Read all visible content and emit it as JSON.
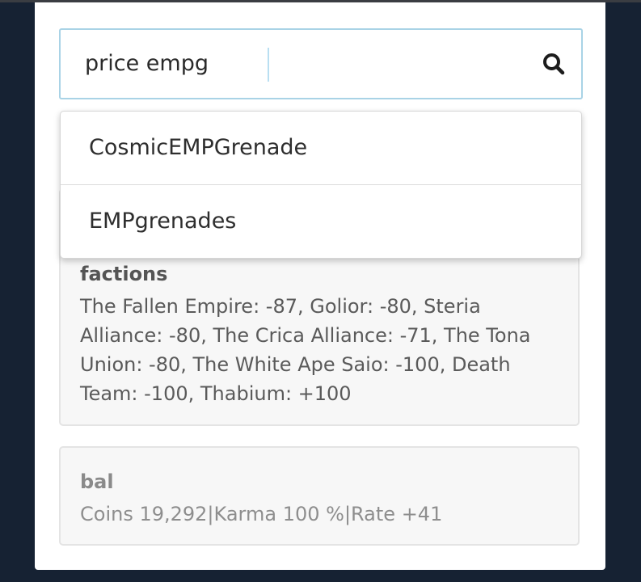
{
  "search": {
    "query": "price empg",
    "suggestions": [
      {
        "label": "CosmicEMPGrenade"
      },
      {
        "label": "EMPgrenades"
      }
    ]
  },
  "cards": {
    "factions": {
      "title": "factions",
      "text": "The Fallen Empire: -87, Golior: -80, Steria Alliance: -80, The Crica Alliance: -71, The Tona Union: -80, The White Ape Saio: -100, Death Team: -100, Thabium: +100"
    },
    "bal": {
      "title": "bal",
      "text": "Coins 19,292|Karma 100 %|Rate +41"
    }
  },
  "icons": {
    "search": "search-icon"
  },
  "colors": {
    "background": "#162233",
    "panel": "#ffffff",
    "search_border": "#a9d3e6",
    "card_bg": "#f7f7f7"
  }
}
